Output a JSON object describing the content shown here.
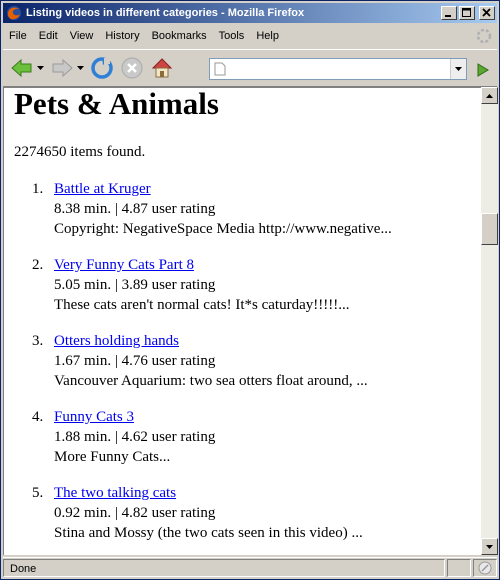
{
  "window": {
    "title": "Listing videos in different categories - Mozilla Firefox"
  },
  "menu": {
    "items": [
      "File",
      "Edit",
      "View",
      "History",
      "Bookmarks",
      "Tools",
      "Help"
    ]
  },
  "navbar": {
    "url_value": "",
    "url_placeholder": ""
  },
  "page": {
    "title": "Pets & Animals",
    "items_found": "2274650 items found.",
    "results": [
      {
        "number": "1.",
        "title": "Battle at Kruger",
        "meta": "8.38 min. | 4.87 user rating",
        "description": "Copyright: NegativeSpace Media http://www.negative..."
      },
      {
        "number": "2.",
        "title": "Very Funny Cats Part 8",
        "meta": "5.05 min. | 3.89 user rating",
        "description": "These cats aren't normal cats! It*s caturday!!!!!..."
      },
      {
        "number": "3.",
        "title": "Otters holding hands",
        "meta": "1.67 min. | 4.76 user rating",
        "description": "Vancouver Aquarium: two sea otters float around, ..."
      },
      {
        "number": "4.",
        "title": "Funny Cats 3",
        "meta": "1.88 min. | 4.62 user rating",
        "description": "More Funny Cats..."
      },
      {
        "number": "5.",
        "title": "The two talking cats",
        "meta": "0.92 min. | 4.82 user rating",
        "description": "Stina and Mossy (the two cats seen in this video) ..."
      }
    ]
  },
  "status": {
    "text": "Done"
  },
  "scroll": {
    "position_fraction": 0.27
  },
  "colors": {
    "titlebar_start": "#0a246a",
    "titlebar_end": "#a6caf0",
    "link": "#0000ee",
    "chrome": "#d4d0c8"
  },
  "icons": {
    "app": "firefox-icon",
    "back": "back-arrow-icon",
    "forward": "forward-arrow-icon",
    "reload": "reload-icon",
    "stop": "stop-icon",
    "home": "home-icon",
    "go": "go-arrow-icon",
    "throbber": "throbber-icon"
  }
}
